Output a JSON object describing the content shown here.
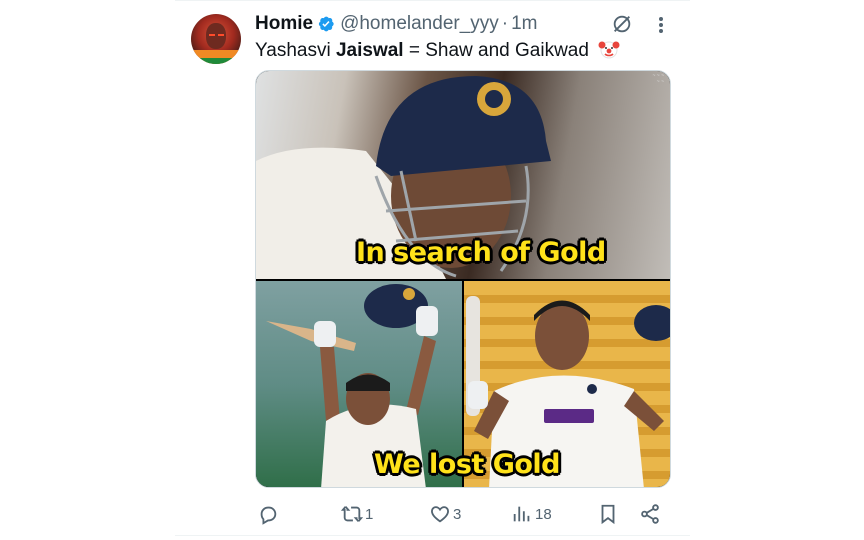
{
  "tweet": {
    "author_name": "Homie",
    "handle": "@homelander_yyy",
    "separator": "·",
    "time": "1m",
    "text_before": "Yashasvi ",
    "text_bold": "Jaiswal",
    "text_after": " = Shaw and Gaikwad",
    "emoji": "clown-face"
  },
  "media": {
    "caption_top": "In search of Gold",
    "caption_bottom": "We lost Gold"
  },
  "actions": {
    "reply_count": "",
    "retweet_count": "1",
    "like_count": "3",
    "views_count": "18"
  },
  "icons": {
    "verified": "verified-badge-icon",
    "grok": "grok-icon",
    "more": "more-icon",
    "reply": "reply-icon",
    "retweet": "retweet-icon",
    "like": "like-icon",
    "views": "views-icon",
    "bookmark": "bookmark-icon",
    "share": "share-icon"
  },
  "colors": {
    "text": "#0f1419",
    "secondary": "#536471",
    "verified": "#1d9bf0",
    "caption": "#ffe21a"
  }
}
